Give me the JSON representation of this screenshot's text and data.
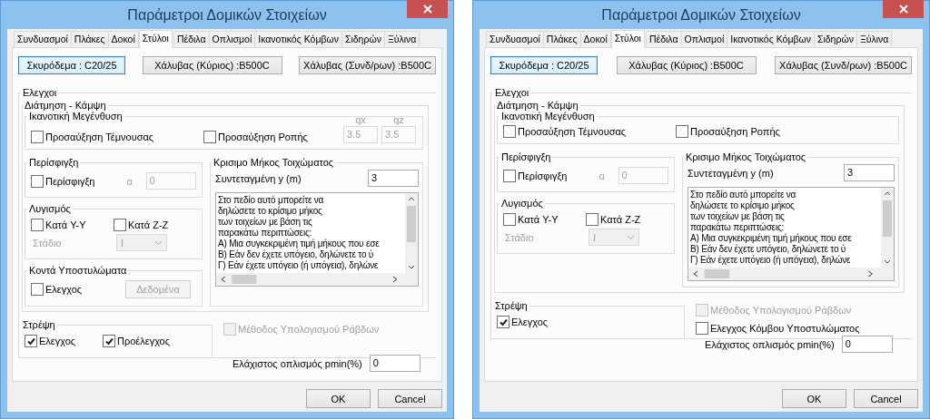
{
  "dialogs": [
    {
      "title": "Παράμετροι Δομικών Στοιχείων",
      "tabs": [
        {
          "label": "Συνδυασμοί",
          "selected": false
        },
        {
          "label": "Πλάκες",
          "selected": false
        },
        {
          "label": "Δοκοί",
          "selected": false
        },
        {
          "label": "Στύλοι",
          "selected": true
        },
        {
          "label": "Πέδιλα",
          "selected": false
        },
        {
          "label": "Οπλισμοί",
          "selected": false
        },
        {
          "label": "Ικανοτικός Κόμβων",
          "selected": false
        },
        {
          "label": "Σιδηρών",
          "selected": false
        },
        {
          "label": "Ξύλινα",
          "selected": false
        }
      ],
      "material_buttons": [
        {
          "label": "Σκυρόδεμα : C20/25",
          "focused": true
        },
        {
          "label": "Χάλυβας  (Κύριος) :B500C",
          "focused": false
        },
        {
          "label": "Χάλυβας  (Συνδ/ρων) :B500C",
          "focused": false
        }
      ],
      "checks_title": "Ελεγχοι",
      "shear_title": "Διάτμηση - Κάμψη",
      "capacity": {
        "title": "Ικανοτική Μεγένθυση",
        "options": [
          {
            "label": "Προσαύξηση Τέμνουσας",
            "checked": false
          },
          {
            "label": "Προσαύξηση Ροπής",
            "checked": false
          }
        ],
        "factors": [
          {
            "label": "qx",
            "value": "3.5",
            "disabled": true
          },
          {
            "label": "qz",
            "value": "3.5",
            "disabled": true
          }
        ]
      },
      "confinement": {
        "title": "Περίσφιγξη",
        "option": {
          "label": "Περίσφιγξη",
          "checked": false
        },
        "alpha": {
          "label": "α",
          "value": "0",
          "disabled": true
        }
      },
      "buckling": {
        "title": "Λυγισμός",
        "options": [
          {
            "label": "Κατά Y-Y",
            "checked": false
          },
          {
            "label": "Κατά Z-Z",
            "checked": false
          }
        ],
        "stage": {
          "label": "Στάδιο",
          "value": "I",
          "disabled": true
        }
      },
      "short_columns": {
        "title": "Κοντά Υποστυλώματα",
        "option": {
          "label": "Ελεγχος",
          "checked": false
        },
        "button": {
          "label": "Δεδομένα",
          "disabled": true
        }
      },
      "critical_length": {
        "title": "Κρισιμο Μήκος Τοιχώματος",
        "field": {
          "label": "Συντεταγμένη y (m)",
          "value": "3"
        },
        "info_lines": [
          "Στο πεδίο αυτό μπορείτε να",
          "δηλώσετε το κρίσιμο μήκος",
          "των τοιχείων με βάση τις",
          "παρακάτω περιπτώσεις:",
          "Α) Μια συγκεκριμένη τιμή μήκους που εσε",
          "Β) Εάν δεν έχετε υπόγειο, δηλώνετε το ύ",
          "Γ) Εάν έχετε υπόγειο (ή υπόγεια), δηλώνε"
        ]
      },
      "torsion": {
        "title": "Στρέψη",
        "options": [
          {
            "label": "Ελεγχος",
            "checked": true
          },
          {
            "label": "Προέλεγχος",
            "checked": true
          }
        ]
      },
      "extra_options": [
        {
          "label": "Μέθοδος Υπολογισμού Ράβδων",
          "checked": false,
          "disabled": true
        }
      ],
      "min_reinforcement": {
        "label": "Ελάχιστος οπλισμός pmin(%)",
        "value": "0"
      },
      "buttons": [
        "OK",
        "Cancel"
      ]
    },
    {
      "title": "Παράμετροι Δομικών Στοιχείων",
      "tabs": [
        {
          "label": "Συνδυασμοί",
          "selected": false
        },
        {
          "label": "Πλάκες",
          "selected": false
        },
        {
          "label": "Δοκοί",
          "selected": false
        },
        {
          "label": "Στύλοι",
          "selected": true
        },
        {
          "label": "Πέδιλα",
          "selected": false
        },
        {
          "label": "Οπλισμοί",
          "selected": false
        },
        {
          "label": "Ικανοτικός Κόμβων",
          "selected": false
        },
        {
          "label": "Σιδηρών",
          "selected": false
        },
        {
          "label": "Ξύλινα",
          "selected": false
        }
      ],
      "material_buttons": [
        {
          "label": "Σκυρόδεμα : C20/25",
          "focused": true
        },
        {
          "label": "Χάλυβας  (Κύριος) :B500C",
          "focused": false
        },
        {
          "label": "Χάλυβας  (Συνδ/ρων) :B500C",
          "focused": false
        }
      ],
      "checks_title": "Ελεγχοι",
      "shear_title": "Διάτμηση - Κάμψη",
      "capacity": {
        "title": "Ικανοτική Μεγένθυση",
        "options": [
          {
            "label": "Προσαύξηση Τέμνουσας",
            "checked": false
          },
          {
            "label": "Προσαύξηση Ροπής",
            "checked": false
          }
        ]
      },
      "confinement": {
        "title": "Περίσφιγξη",
        "option": {
          "label": "Περίσφιγξη",
          "checked": false
        },
        "alpha": {
          "label": "α",
          "value": "0",
          "disabled": true
        }
      },
      "buckling": {
        "title": "Λυγισμός",
        "options": [
          {
            "label": "Κατά Y-Y",
            "checked": false
          },
          {
            "label": "Κατά Z-Z",
            "checked": false
          }
        ],
        "stage": {
          "label": "Στάδιο",
          "value": "I",
          "disabled": true
        }
      },
      "critical_length": {
        "title": "Κρισιμο Μήκος Τοιχώματος",
        "field": {
          "label": "Συντεταγμένη y (m)",
          "value": "3"
        },
        "info_lines": [
          "Στο πεδίο αυτό μπορείτε να",
          "δηλώσετε το κρίσιμο μήκος",
          "των τοιχείων με βάση τις",
          "παρακάτω περιπτώσεις:",
          "Α) Μια συγκεκριμένη τιμή μήκους που εσε",
          "Β) Εάν δεν έχετε υπόγειο, δηλώνετε το ύ",
          "Γ) Εάν έχετε υπόγειο (ή υπόγεια), δηλώνε"
        ]
      },
      "torsion": {
        "title": "Στρέψη",
        "options": [
          {
            "label": "Ελεγχος",
            "checked": true
          }
        ]
      },
      "extra_options": [
        {
          "label": "Μέθοδος Υπολογισμού Ράβδων",
          "checked": false,
          "disabled": true
        },
        {
          "label": "Ελεγχος Κόμβου Υποστυλώματος",
          "checked": false,
          "disabled": false
        }
      ],
      "min_reinforcement": {
        "label": "Ελάχιστος οπλισμός pmin(%)",
        "value": "0"
      },
      "buttons": [
        "OK",
        "Cancel"
      ]
    }
  ]
}
